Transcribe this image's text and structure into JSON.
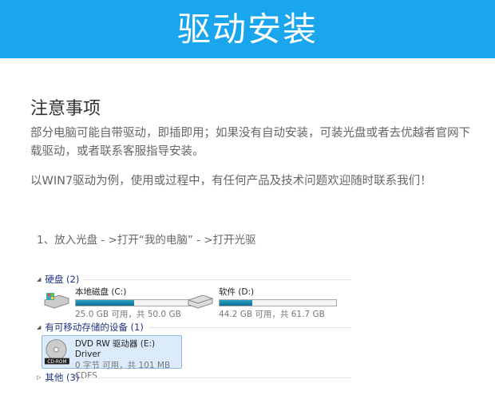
{
  "header": {
    "title": "驱动安装"
  },
  "notes": {
    "title": "注意事项",
    "para1": "部分电脑可能自带驱动，即插即用；如果没有自动安装，可装光盘或者去优越者官网下载驱动，或者联系客服指导安装。",
    "para2": "以WIN7驱动为例，使用或过程中，有任何产品及技术问题欢迎随时联系我们！"
  },
  "step": "1、放入光盘 - >打开“我的电脑” - >打开光驱",
  "explorer": {
    "groups": [
      {
        "label": "硬盘 (2)"
      },
      {
        "label": "有可移动存储的设备 (1)"
      },
      {
        "label": "其他 (3)"
      }
    ],
    "drives": [
      {
        "name": "本地磁盘 (C:)",
        "info": "25.0 GB 可用，共 50.0 GB",
        "used_percent": 50
      },
      {
        "name": "软件 (D:)",
        "info": "44.2 GB 可用，共 61.7 GB",
        "used_percent": 28
      }
    ],
    "dvd": {
      "name": "DVD RW 驱动器 (E:) Driver",
      "info": "0 字节 可用，共 101 MB",
      "fs": "CDFS",
      "badge": "CD-ROM"
    }
  }
}
